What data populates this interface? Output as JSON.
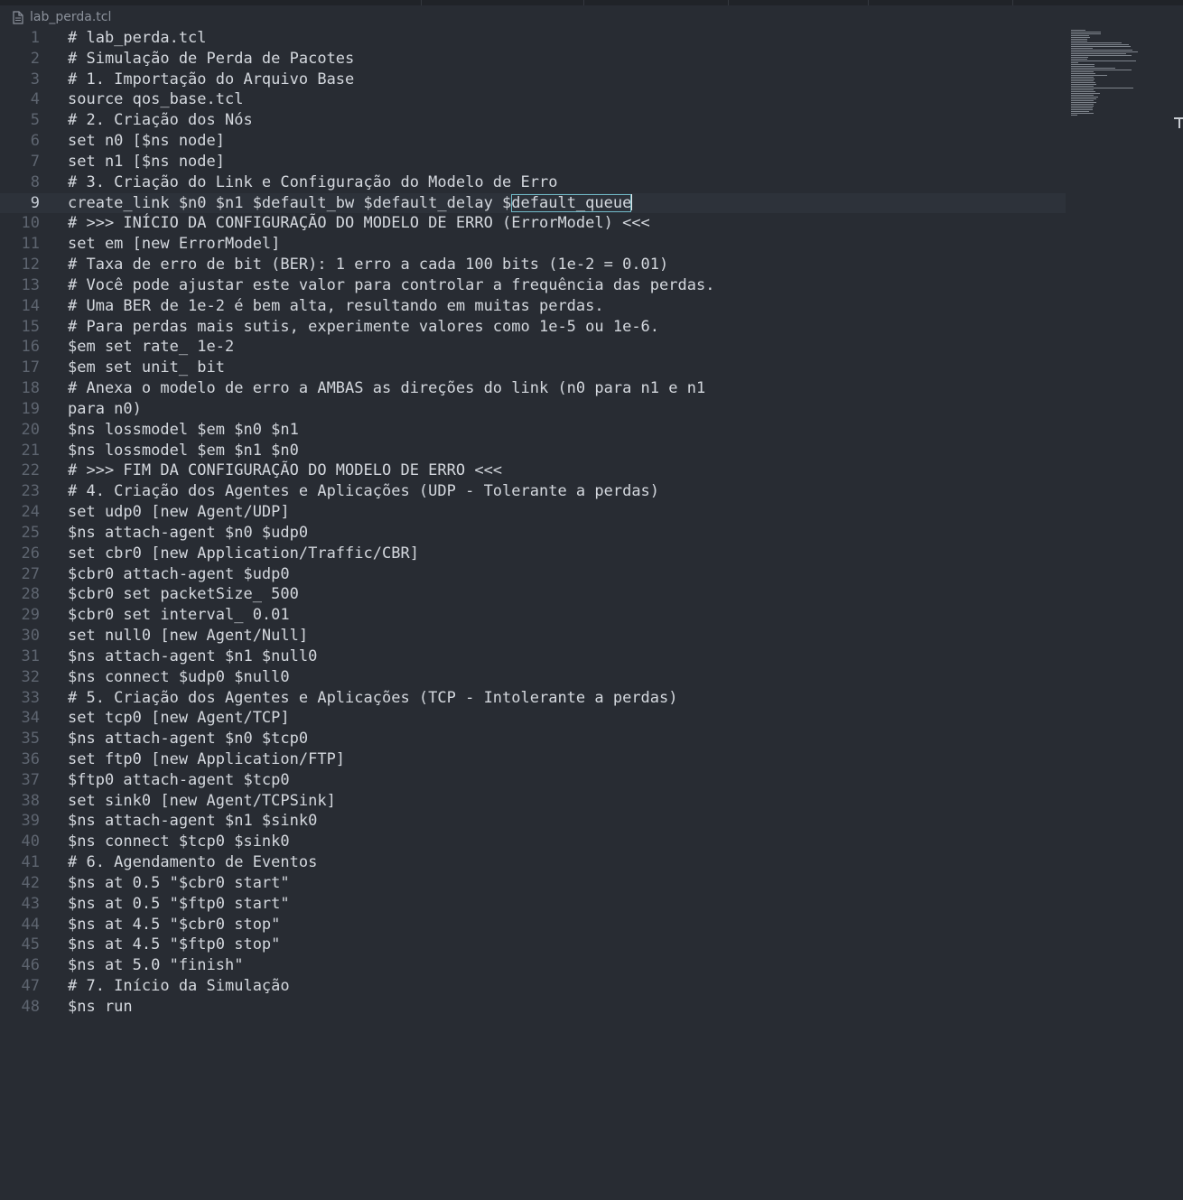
{
  "tab": {
    "file_name": "lab_perda.tcl",
    "icon": "file-icon"
  },
  "editor": {
    "current_line": 9,
    "lines": [
      {
        "n": "1",
        "text": "# lab_perda.tcl"
      },
      {
        "n": "2",
        "text": "# Simulação de Perda de Pacotes"
      },
      {
        "n": "3",
        "text": "# 1. Importação do Arquivo Base"
      },
      {
        "n": "4",
        "text": "source qos_base.tcl"
      },
      {
        "n": "5",
        "text": "# 2. Criação dos Nós"
      },
      {
        "n": "6",
        "text": "set n0 [$ns node]"
      },
      {
        "n": "7",
        "text": "set n1 [$ns node]"
      },
      {
        "n": "8",
        "text": "# 3. Criação do Link e Configuração do Modelo de Erro"
      },
      {
        "n": "9",
        "text": "create_link $n0 $n1 $default_bw $default_delay $",
        "selected": "default_queue"
      },
      {
        "n": "10",
        "text": "# >>> INÍCIO DA CONFIGURAÇÃO DO MODELO DE ERRO (ErrorModel) <<<"
      },
      {
        "n": "11",
        "text": "set em [new ErrorModel]"
      },
      {
        "n": "12",
        "text": "# Taxa de erro de bit (BER): 1 erro a cada 100 bits (1e-2 = 0.01)"
      },
      {
        "n": "13",
        "text": "# Você pode ajustar este valor para controlar a frequência das perdas."
      },
      {
        "n": "14",
        "text": "# Uma BER de 1e-2 é bem alta, resultando em muitas perdas."
      },
      {
        "n": "15",
        "text": "# Para perdas mais sutis, experimente valores como 1e-5 ou 1e-6."
      },
      {
        "n": "16",
        "text": "$em set rate_ 1e-2"
      },
      {
        "n": "17",
        "text": "$em set unit_ bit"
      },
      {
        "n": "18",
        "text": "# Anexa o modelo de erro a AMBAS as direções do link (n0 para n1 e n1"
      },
      {
        "n": "19",
        "text": "para n0)"
      },
      {
        "n": "20",
        "text": "$ns lossmodel $em $n0 $n1"
      },
      {
        "n": "21",
        "text": "$ns lossmodel $em $n1 $n0"
      },
      {
        "n": "22",
        "text": "# >>> FIM DA CONFIGURAÇÃO DO MODELO DE ERRO <<<"
      },
      {
        "n": "23",
        "text": "# 4. Criação dos Agentes e Aplicações (UDP - Tolerante a perdas)"
      },
      {
        "n": "24",
        "text": "set udp0 [new Agent/UDP]"
      },
      {
        "n": "25",
        "text": "$ns attach-agent $n0 $udp0"
      },
      {
        "n": "26",
        "text": "set cbr0 [new Application/Traffic/CBR]"
      },
      {
        "n": "27",
        "text": "$cbr0 attach-agent $udp0"
      },
      {
        "n": "28",
        "text": "$cbr0 set packetSize_ 500"
      },
      {
        "n": "29",
        "text": "$cbr0 set interval_ 0.01"
      },
      {
        "n": "30",
        "text": "set null0 [new Agent/Null]"
      },
      {
        "n": "31",
        "text": "$ns attach-agent $n1 $null0"
      },
      {
        "n": "32",
        "text": "$ns connect $udp0 $null0"
      },
      {
        "n": "33",
        "text": "# 5. Criação dos Agentes e Aplicações (TCP - Intolerante a perdas)"
      },
      {
        "n": "34",
        "text": "set tcp0 [new Agent/TCP]"
      },
      {
        "n": "35",
        "text": "$ns attach-agent $n0 $tcp0"
      },
      {
        "n": "36",
        "text": "set ftp0 [new Application/FTP]"
      },
      {
        "n": "37",
        "text": "$ftp0 attach-agent $tcp0"
      },
      {
        "n": "38",
        "text": "set sink0 [new Agent/TCPSink]"
      },
      {
        "n": "39",
        "text": "$ns attach-agent $n1 $sink0"
      },
      {
        "n": "40",
        "text": "$ns connect $tcp0 $sink0"
      },
      {
        "n": "41",
        "text": "# 6. Agendamento de Eventos"
      },
      {
        "n": "42",
        "text": "$ns at 0.5 \"$cbr0 start\""
      },
      {
        "n": "43",
        "text": "$ns at 0.5 \"$ftp0 start\""
      },
      {
        "n": "44",
        "text": "$ns at 4.5 \"$cbr0 stop\""
      },
      {
        "n": "45",
        "text": "$ns at 4.5 \"$ftp0 stop\""
      },
      {
        "n": "46",
        "text": "$ns at 5.0 \"finish\""
      },
      {
        "n": "47",
        "text": "# 7. Início da Simulação"
      },
      {
        "n": "48",
        "text": "$ns run"
      }
    ]
  }
}
